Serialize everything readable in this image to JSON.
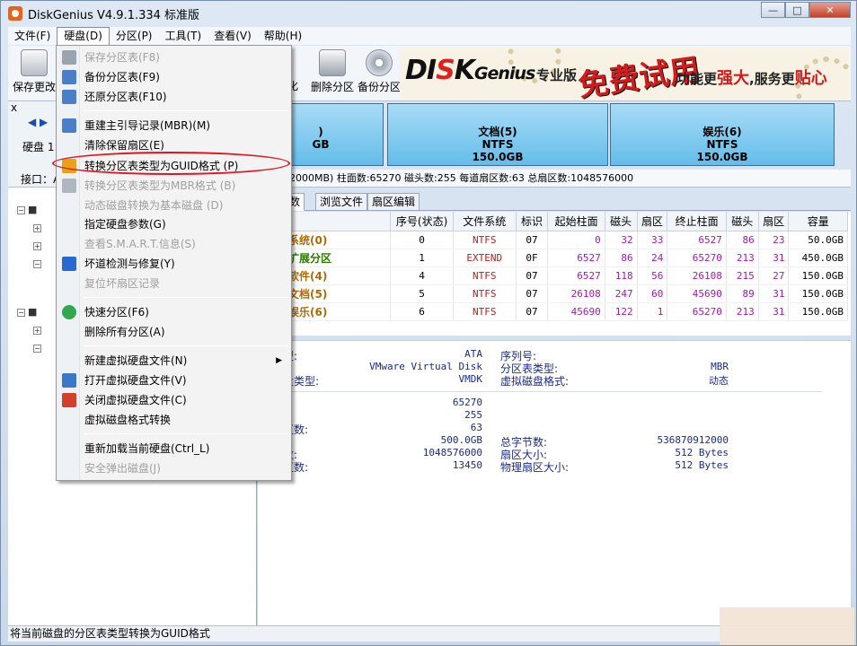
{
  "window": {
    "title": "DiskGenius V4.9.1.334 标准版",
    "min": "—",
    "max": "□",
    "close": "✕"
  },
  "menubar": [
    {
      "label": "文件(F)"
    },
    {
      "label": "硬盘(D)"
    },
    {
      "label": "分区(P)"
    },
    {
      "label": "工具(T)"
    },
    {
      "label": "查看(V)"
    },
    {
      "label": "帮助(H)"
    }
  ],
  "toolbar": {
    "save": "保存更改",
    "partial": "化",
    "delete": "删除分区",
    "backup": "备份分区"
  },
  "banner": {
    "logo_a": "DI",
    "logo_b": "S",
    "logo_c": "K",
    "logo_d": "Genius",
    "pro": "专业版",
    "free": "免费试用",
    "slogan_a": "功能更",
    "slogan_b": "强大",
    "slogan_c": ",服务更",
    "slogan_d": "贴心"
  },
  "left_panel": {
    "nav": "◀ ▶",
    "disk": "硬盘 1",
    "port": "接口：A",
    "close": "x"
  },
  "disk_map": [
    {
      "name": ")",
      "fs": "",
      "size": "GB"
    },
    {
      "name": "文档(5)",
      "fs": "NTFS",
      "size": "150.0GB"
    },
    {
      "name": "娱乐(6)",
      "fs": "NTFS",
      "size": "150.0GB"
    }
  ],
  "disk_info": "12000MB)  柱面数:65270  磁头数:255  每道扇区数:63  总扇区数:1048576000",
  "tabs": [
    {
      "label": "参数"
    },
    {
      "label": "浏览文件"
    },
    {
      "label": "扇区编辑"
    }
  ],
  "partition_table": {
    "headers": [
      "",
      "序号(状态)",
      "文件系统",
      "标识",
      "起始柱面",
      "磁头",
      "扇区",
      "终止柱面",
      "磁头",
      "扇区",
      "容量"
    ],
    "rows": [
      {
        "name": "系统(0)",
        "seq": "0",
        "fs": "NTFS",
        "id": "07",
        "sc": "0",
        "sh": "32",
        "ss": "33",
        "ec": "6527",
        "eh": "86",
        "es": "23",
        "size": "50.0GB",
        "ext": false
      },
      {
        "name": "扩展分区",
        "seq": "1",
        "fs": "EXTEND",
        "id": "0F",
        "sc": "6527",
        "sh": "86",
        "ss": "24",
        "ec": "65270",
        "eh": "213",
        "es": "31",
        "size": "450.0GB",
        "ext": true
      },
      {
        "name": "软件(4)",
        "seq": "4",
        "fs": "NTFS",
        "id": "07",
        "sc": "6527",
        "sh": "118",
        "ss": "56",
        "ec": "26108",
        "eh": "215",
        "es": "27",
        "size": "150.0GB",
        "ext": false
      },
      {
        "name": "文档(5)",
        "seq": "5",
        "fs": "NTFS",
        "id": "07",
        "sc": "26108",
        "sh": "247",
        "ss": "60",
        "ec": "45690",
        "eh": "89",
        "es": "31",
        "size": "150.0GB",
        "ext": false
      },
      {
        "name": "娱乐(6)",
        "seq": "6",
        "fs": "NTFS",
        "id": "07",
        "sc": "45690",
        "sh": "122",
        "ss": "1",
        "ec": "65270",
        "eh": "213",
        "es": "31",
        "size": "150.0GB",
        "ext": false
      }
    ]
  },
  "details": {
    "left": [
      {
        "label": "型:",
        "value": "ATA"
      },
      {
        "label": "",
        "value": "VMware Virtual Disk"
      },
      {
        "label": "盘类型:",
        "value": "VMDK"
      },
      {
        "label": ":",
        "value": "65270"
      },
      {
        "label": ":",
        "value": "255"
      },
      {
        "label": "区数:",
        "value": "63"
      },
      {
        "label": ":",
        "value": "500.0GB"
      },
      {
        "label": "数:",
        "value": "1048576000"
      },
      {
        "label": "区数:",
        "value": "13450"
      }
    ],
    "right": [
      {
        "label": "序列号:",
        "value": ""
      },
      {
        "label": "分区表类型:",
        "value": "MBR"
      },
      {
        "label": "虚拟磁盘格式:",
        "value": "动态"
      },
      {
        "label": "总字节数:",
        "value": "536870912000"
      },
      {
        "label": "扇区大小:",
        "value": "512 Bytes"
      },
      {
        "label": "物理扇区大小:",
        "value": "512 Bytes"
      }
    ]
  },
  "dropdown": {
    "items": [
      {
        "label": "保存分区表(F8)",
        "disabled": true
      },
      {
        "label": "备份分区表(F9)",
        "disabled": false
      },
      {
        "label": "还原分区表(F10)",
        "disabled": false
      },
      {
        "label": "重建主引导记录(MBR)(M)",
        "disabled": false
      },
      {
        "label": "清除保留扇区(E)",
        "disabled": false
      },
      {
        "label": "转换分区表类型为GUID格式 (P)",
        "disabled": false
      },
      {
        "label": "转换分区表类型为MBR格式 (B)",
        "disabled": true
      },
      {
        "label": "动态磁盘转换为基本磁盘 (D)",
        "disabled": true
      },
      {
        "label": "指定硬盘参数(G)",
        "disabled": false
      },
      {
        "label": "查看S.M.A.R.T.信息(S)",
        "disabled": true
      },
      {
        "label": "坏道检测与修复(Y)",
        "disabled": false
      },
      {
        "label": "复位坏扇区记录",
        "disabled": true
      },
      {
        "label": "快速分区(F6)",
        "disabled": false
      },
      {
        "label": "删除所有分区(A)",
        "disabled": false
      },
      {
        "label": "新建虚拟硬盘文件(N)",
        "disabled": false
      },
      {
        "label": "打开虚拟硬盘文件(V)",
        "disabled": false
      },
      {
        "label": "关闭虚拟硬盘文件(C)",
        "disabled": false
      },
      {
        "label": "虚拟磁盘格式转换",
        "disabled": false
      },
      {
        "label": "重新加载当前硬盘(Ctrl_L)",
        "disabled": false
      },
      {
        "label": "安全弹出磁盘(J)",
        "disabled": true
      }
    ]
  },
  "statusbar": "将当前磁盘的分区表类型转换为GUID格式",
  "colors": {
    "accent": "#e0141e",
    "partition_fill": "#64bde9",
    "highlight_ring": "#e0141e"
  }
}
